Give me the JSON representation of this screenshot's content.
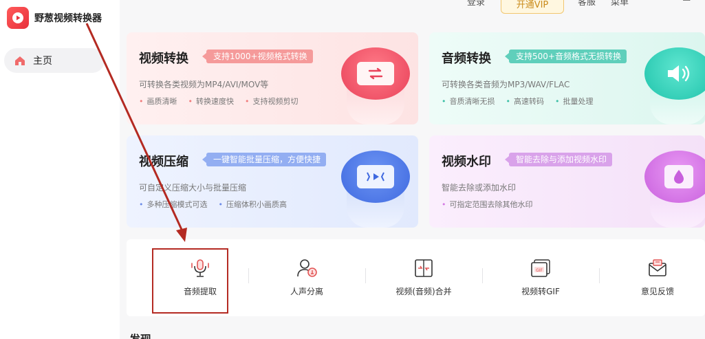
{
  "app": {
    "title": "野葱视频转换器"
  },
  "sidebar": {
    "items": [
      {
        "label": "主页",
        "active": true
      }
    ]
  },
  "topbar": {
    "login": "登录",
    "vip": "开通VIP",
    "service": "客服",
    "menu": "菜单"
  },
  "cards": [
    {
      "title": "视频转换",
      "tag": "支持1000+视频格式转换",
      "desc": "可转换各类视频为MP4/AVI/MOV等",
      "bullets": [
        "画质清晰",
        "转换速度快",
        "支持视频剪切"
      ]
    },
    {
      "title": "音频转换",
      "tag": "支持500+音频格式无损转换",
      "desc": "可转换各类音频为MP3/WAV/FLAC",
      "bullets": [
        "音质清晰无损",
        "高速转码",
        "批量处理"
      ]
    },
    {
      "title": "视频压缩",
      "tag": "一键智能批量压缩，方便快捷",
      "desc": "可自定义压缩大小与批量压缩",
      "bullets": [
        "多种压缩模式可选",
        "压缩体积小画质高"
      ]
    },
    {
      "title": "视频水印",
      "tag": "智能去除与添加视频水印",
      "desc": "智能去除或添加水印",
      "bullets": [
        "可指定范围去除其他水印"
      ]
    }
  ],
  "tools": [
    {
      "label": "音频提取",
      "icon": "microphone-icon"
    },
    {
      "label": "人声分离",
      "icon": "vocal-separation-icon"
    },
    {
      "label": "视频(音频)合并",
      "icon": "merge-icon"
    },
    {
      "label": "视频转GIF",
      "icon": "gif-icon"
    },
    {
      "label": "意见反馈",
      "icon": "feedback-mail-icon"
    }
  ],
  "section": {
    "title": "发现"
  },
  "colors": {
    "accent": "#e8313c",
    "annotation": "#b42a22",
    "vip_border": "#f1c66f"
  }
}
